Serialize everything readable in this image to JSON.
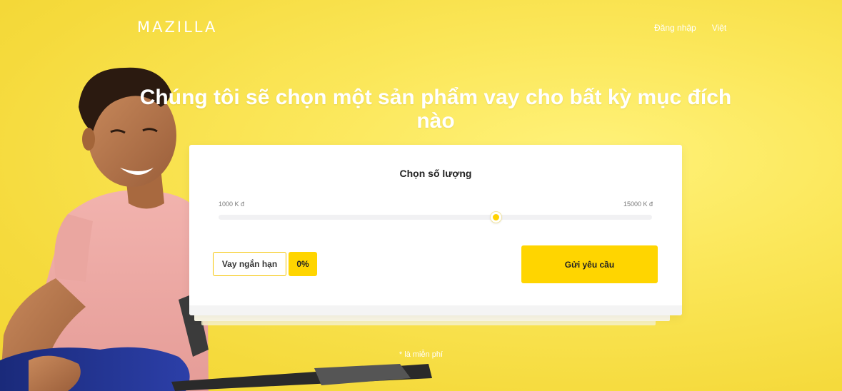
{
  "header": {
    "logo": "MAZILLA",
    "nav": [
      {
        "label": "Đăng nhập"
      },
      {
        "label": "Việt"
      }
    ]
  },
  "hero": {
    "headline": "Chúng tôi sẽ chọn một sản phẩm vay cho bất kỳ mục đích nào"
  },
  "calculator": {
    "title": "Chọn số lượng",
    "range_min_label": "1000 K đ",
    "range_max_label": "15000 K đ",
    "slider_fraction": 0.64,
    "loan_type_label": "Vay ngắn hạn",
    "rate_label": "0%",
    "submit_label": "Gửi yêu cầu"
  },
  "footnote": "* là miễn phí",
  "colors": {
    "accent": "#ffd500",
    "background": "#f5da3c",
    "text_on_bg": "#ffffff"
  }
}
